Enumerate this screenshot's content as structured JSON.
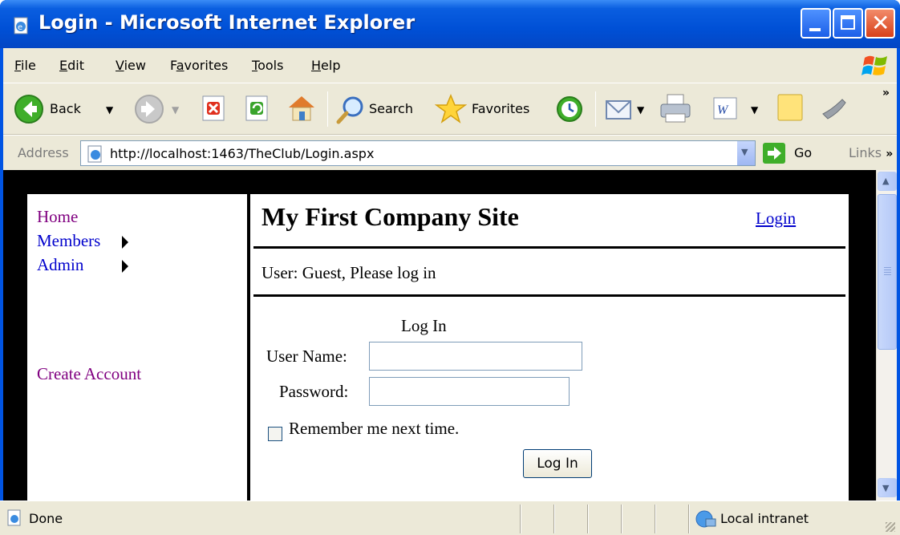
{
  "window": {
    "title": "Login - Microsoft Internet Explorer"
  },
  "menu": {
    "items": [
      {
        "label": "File",
        "underline": "F",
        "rest": "ile"
      },
      {
        "label": "Edit",
        "underline": "E",
        "rest": "dit"
      },
      {
        "label": "View",
        "underline": "V",
        "rest": "iew"
      },
      {
        "label": "Favorites",
        "underline": "a",
        "pre": "F",
        "rest": "vorites"
      },
      {
        "label": "Tools",
        "underline": "T",
        "rest": "ools"
      },
      {
        "label": "Help",
        "underline": "H",
        "rest": "elp"
      }
    ]
  },
  "toolbar": {
    "back_label": "Back",
    "search_label": "Search",
    "favorites_label": "Favorites",
    "overflow": "»"
  },
  "address": {
    "label": "Address",
    "url": "http://localhost:1463/TheClub/Login.aspx",
    "go_label": "Go",
    "links_label": "Links",
    "overflow": "»"
  },
  "page": {
    "nav": {
      "home": "Home",
      "members": "Members",
      "admin": "Admin",
      "create_account": "Create Account"
    },
    "site_title": "My First Company Site",
    "login_link": "Login",
    "user_status": "User: Guest, Please log in",
    "login_form": {
      "heading": "Log In",
      "username_label": "User Name:",
      "username_value": "",
      "password_label": "Password:",
      "password_value": "",
      "remember_label": "Remember me next time.",
      "remember_checked": false,
      "submit_label": "Log In"
    }
  },
  "status": {
    "text": "Done",
    "zone": "Local intranet"
  },
  "colors": {
    "titlebar": "#0054e3",
    "chrome": "#ece9d8",
    "visited_link": "#800080",
    "link": "#0000cc"
  }
}
